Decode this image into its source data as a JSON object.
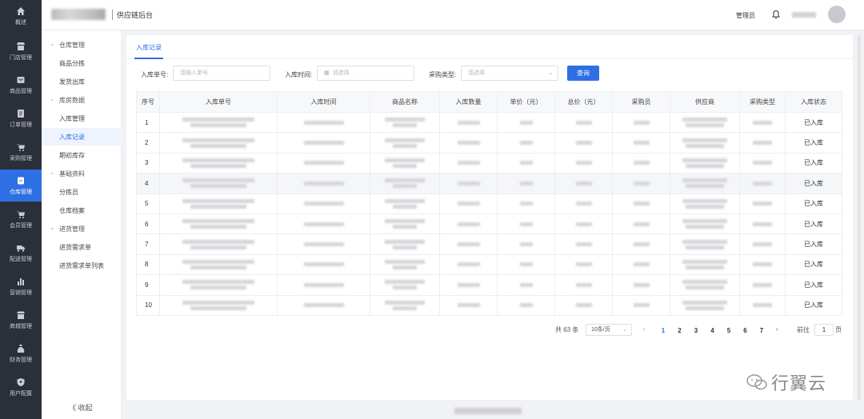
{
  "rail": [
    {
      "name": "overview",
      "label": "概述",
      "icon": "home-icon"
    },
    {
      "name": "store",
      "label": "门店管理",
      "icon": "store-icon"
    },
    {
      "name": "goods",
      "label": "商品管理",
      "icon": "goods-icon"
    },
    {
      "name": "orders",
      "label": "订单管理",
      "icon": "order-icon"
    },
    {
      "name": "purchase",
      "label": "采购管理",
      "icon": "cart-icon"
    },
    {
      "name": "warehouse",
      "label": "仓库管理",
      "icon": "warehouse-icon"
    },
    {
      "name": "member",
      "label": "会员管理",
      "icon": "member-icon"
    },
    {
      "name": "delivery",
      "label": "配送管理",
      "icon": "truck-icon"
    },
    {
      "name": "marketing",
      "label": "营销管理",
      "icon": "chart-icon"
    },
    {
      "name": "mall",
      "label": "商城管理",
      "icon": "shop-icon"
    },
    {
      "name": "finance",
      "label": "财务管理",
      "icon": "money-icon"
    },
    {
      "name": "user",
      "label": "用户配置",
      "icon": "shield-icon"
    }
  ],
  "header": {
    "title": "供应链后台",
    "admin": "管理员"
  },
  "submenu": {
    "groups": [
      {
        "label": "仓库管理",
        "items": [
          "商品分拣",
          "发货出库"
        ]
      },
      {
        "label": "库房数据",
        "items": [
          "入库管理",
          "入库记录",
          "期初库存"
        ]
      },
      {
        "label": "基础资料",
        "items": [
          "分拣员",
          "仓库档案"
        ]
      },
      {
        "label": "进货管理",
        "items": [
          "进货需求单",
          "进货需求单列表"
        ]
      }
    ],
    "collapse": "收起"
  },
  "tab": "入库记录",
  "filters": {
    "order_no_label": "入库单号:",
    "order_no_placeholder": "请输入单号",
    "time_label": "入库时间:",
    "time_placeholder": "请选择",
    "type_label": "采购类型:",
    "type_placeholder": "请选择",
    "query": "查询"
  },
  "table": {
    "columns": [
      "序号",
      "入库单号",
      "入库时间",
      "商品名称",
      "入库数量",
      "单价（元）",
      "总价（元）",
      "采购员",
      "供应商",
      "采购类型",
      "入库状态"
    ],
    "rows": [
      {
        "index": "1",
        "status": "已入库"
      },
      {
        "index": "2",
        "status": "已入库"
      },
      {
        "index": "3",
        "status": "已入库"
      },
      {
        "index": "4",
        "status": "已入库"
      },
      {
        "index": "5",
        "status": "已入库"
      },
      {
        "index": "6",
        "status": "已入库"
      },
      {
        "index": "7",
        "status": "已入库"
      },
      {
        "index": "8",
        "status": "已入库"
      },
      {
        "index": "9",
        "status": "已入库"
      },
      {
        "index": "10",
        "status": "已入库"
      }
    ]
  },
  "pagination": {
    "total": "共 63 条",
    "page_size": "10条/页",
    "pages": [
      "1",
      "2",
      "3",
      "4",
      "5",
      "6",
      "7"
    ],
    "current": "1",
    "goto_label": "前往",
    "goto_value": "1",
    "page_unit": "页"
  },
  "watermark": "行翼云",
  "colors": {
    "accent": "#2f6fe4",
    "rail_bg": "#2b2f3a"
  }
}
